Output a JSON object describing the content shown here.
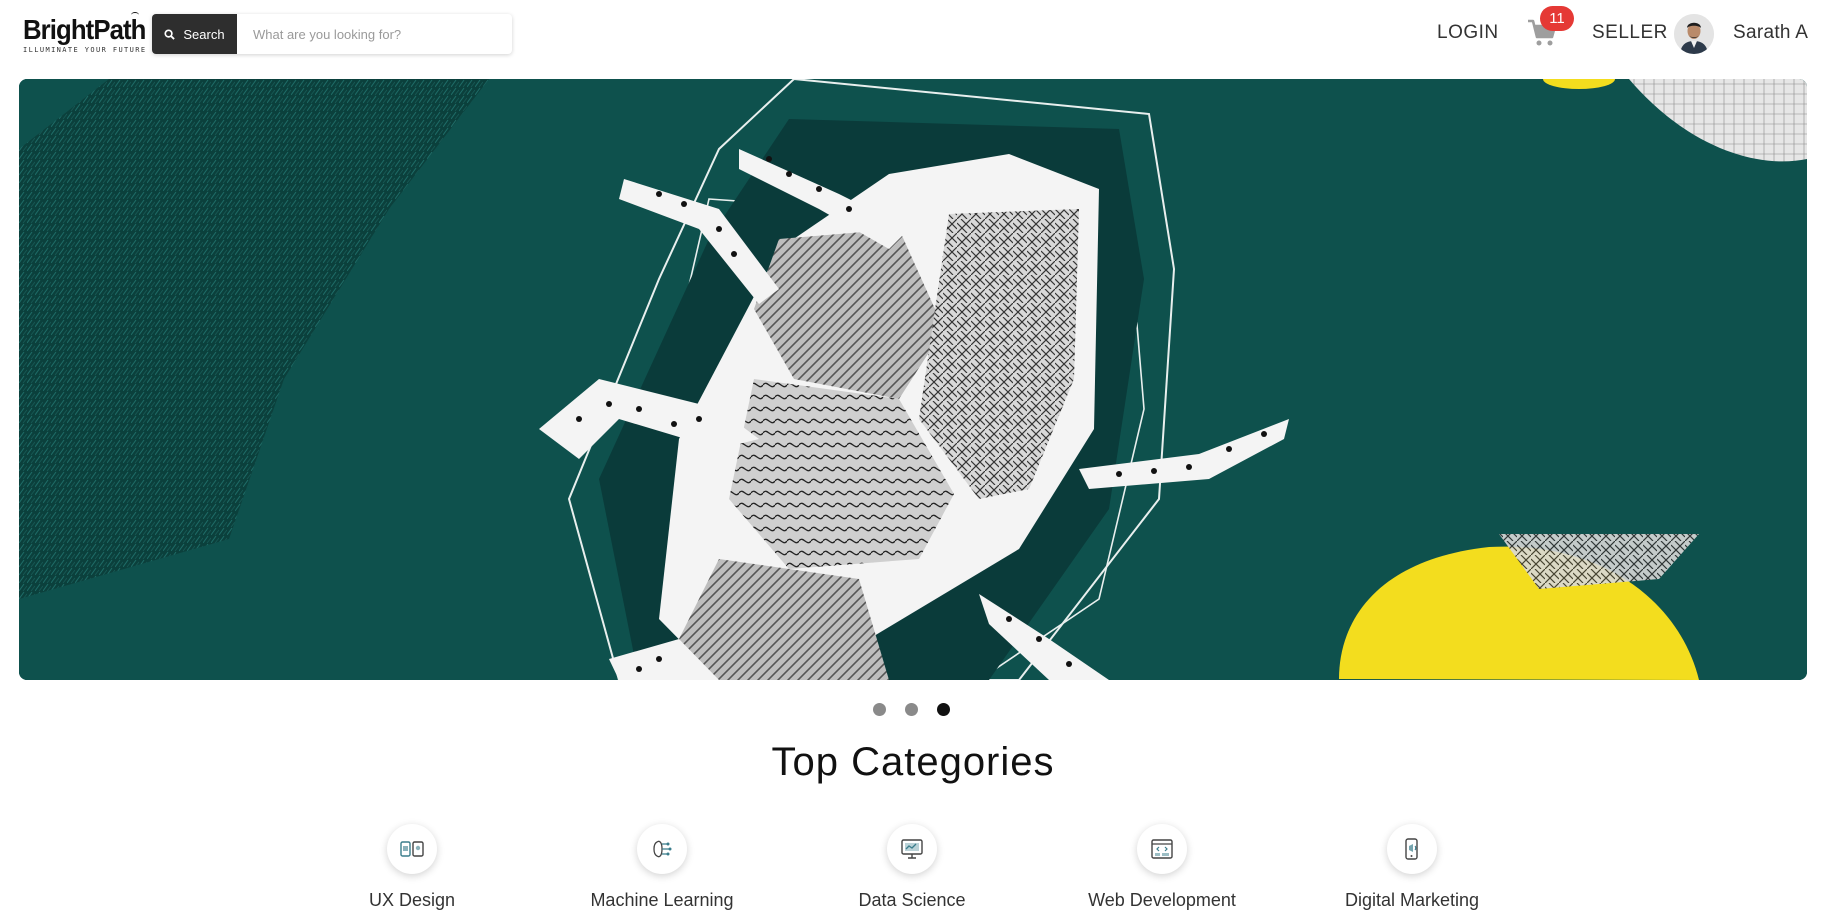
{
  "brand": {
    "name": "BrightPath",
    "tagline": "ILLUMINATE YOUR FUTURE"
  },
  "search": {
    "button_label": "Search",
    "placeholder": "What are you looking for?",
    "value": ""
  },
  "nav": {
    "login_label": "LOGIN",
    "cart_count": "11",
    "seller_label": "SELLER",
    "user_name": "Sarath A"
  },
  "carousel": {
    "slide_count": 3,
    "active_index": 2,
    "colors": {
      "background": "#0e514d",
      "accent_yellow": "#f3dd1e"
    }
  },
  "categories": {
    "title": "Top Categories",
    "items": [
      {
        "label": "UX Design",
        "icon": "ux-design-icon"
      },
      {
        "label": "Machine Learning",
        "icon": "machine-learning-icon"
      },
      {
        "label": "Data Science",
        "icon": "data-science-icon"
      },
      {
        "label": "Web Development",
        "icon": "web-development-icon"
      },
      {
        "label": "Digital Marketing",
        "icon": "digital-marketing-icon"
      }
    ]
  },
  "colors": {
    "badge": "#e53935",
    "search_button": "#2e2e2e",
    "active_dot": "#111111",
    "inactive_dot": "#8a8a8a"
  }
}
